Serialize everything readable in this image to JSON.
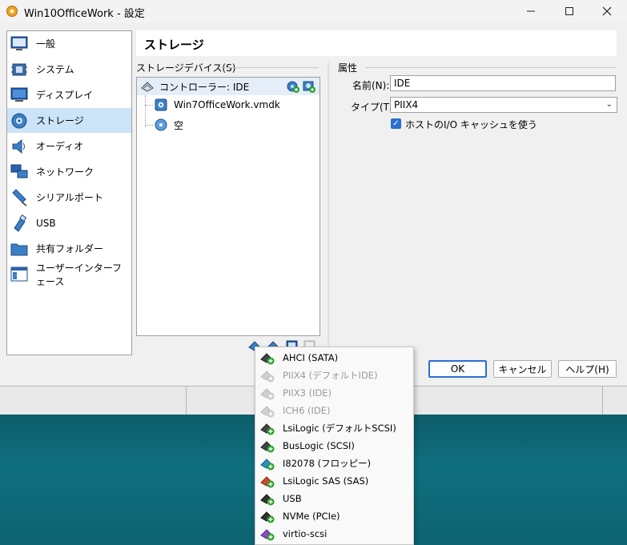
{
  "window": {
    "title": "Win10OfficeWork - 設定",
    "controls": [
      "minimize",
      "maximize",
      "close"
    ]
  },
  "sidebar": {
    "items": [
      {
        "label": "一般",
        "icon": "general-monitor-icon"
      },
      {
        "label": "システム",
        "icon": "system-chip-icon"
      },
      {
        "label": "ディスプレイ",
        "icon": "display-monitor-icon"
      },
      {
        "label": "ストレージ",
        "icon": "storage-disk-icon",
        "selected": true
      },
      {
        "label": "オーディオ",
        "icon": "audio-speaker-icon"
      },
      {
        "label": "ネットワーク",
        "icon": "network-icon"
      },
      {
        "label": "シリアルポート",
        "icon": "serial-port-icon"
      },
      {
        "label": "USB",
        "icon": "usb-icon"
      },
      {
        "label": "共有フォルダー",
        "icon": "shared-folder-icon"
      },
      {
        "label": "ユーザーインターフェース",
        "icon": "user-interface-icon"
      }
    ]
  },
  "page": {
    "title": "ストレージ"
  },
  "storage_devices": {
    "caption": "ストレージデバイス(S)",
    "controller": "コントローラー: IDE",
    "children": [
      {
        "label": "Win7OfficeWork.vmdk",
        "icon": "hard-disk-icon"
      },
      {
        "label": "空",
        "icon": "optical-disc-icon"
      }
    ]
  },
  "attributes": {
    "caption": "属性",
    "name_label": "名前(N):",
    "name_value": "IDE",
    "type_label": "タイプ(T):",
    "type_value": "PIIX4",
    "use_host_cache_label": "ホストのI/O キャッシュを使う",
    "use_host_cache_checked": true
  },
  "buttons": {
    "ok": "OK",
    "cancel": "キャンセル",
    "help": "ヘルプ(H)"
  },
  "add_controller_menu": {
    "items": [
      {
        "label": "AHCI (SATA)",
        "enabled": true,
        "color": "#2aa02a"
      },
      {
        "label": "PIIX4 (デフォルトIDE)",
        "enabled": false,
        "color": "#bdbdbd"
      },
      {
        "label": "PIIX3 (IDE)",
        "enabled": false,
        "color": "#bdbdbd"
      },
      {
        "label": "ICH6 (IDE)",
        "enabled": false,
        "color": "#bdbdbd"
      },
      {
        "label": "LsiLogic (デフォルトSCSI)",
        "enabled": true,
        "color": "#2aa02a"
      },
      {
        "label": "BusLogic (SCSI)",
        "enabled": true,
        "color": "#2aa02a"
      },
      {
        "label": "I82078 (フロッピー)",
        "enabled": true,
        "color": "#2a90c8"
      },
      {
        "label": "LsiLogic SAS (SAS)",
        "enabled": true,
        "color": "#d04a2a"
      },
      {
        "label": "USB",
        "enabled": true,
        "color": "#2aa02a"
      },
      {
        "label": "NVMe (PCIe)",
        "enabled": true,
        "color": "#2aa02a"
      },
      {
        "label": "virtio-scsi",
        "enabled": true,
        "color": "#8a4ac8"
      }
    ]
  }
}
